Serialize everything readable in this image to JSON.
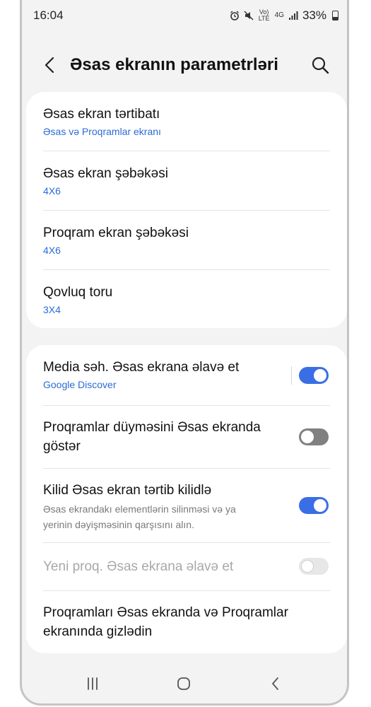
{
  "status": {
    "time": "16:04",
    "volte": "Vo) LTE",
    "network": "4G",
    "battery": "33%",
    "icons": [
      "alarm-icon",
      "mute-icon",
      "volte-icon",
      "4g-icon",
      "signal-icon",
      "battery-icon"
    ]
  },
  "header": {
    "title": "Əsas ekranın parametrləri",
    "back_icon": "back-icon",
    "search_icon": "search-icon"
  },
  "card1": {
    "items": [
      {
        "title": "Əsas ekran tərtibatı",
        "subtitle": "Əsas və Proqramlar ekranı"
      },
      {
        "title": "Əsas ekran şəbəkəsi",
        "subtitle": "4X6"
      },
      {
        "title": "Proqram ekran şəbəkəsi",
        "subtitle": "4X6"
      },
      {
        "title": "Qovluq toru",
        "subtitle": "3X4"
      }
    ]
  },
  "card2": {
    "items": [
      {
        "title": "Media səh. Əsas ekrana əlavə et",
        "subtitle": "Google Discover",
        "toggle": "on"
      },
      {
        "title_line1": "Proqramlar düyməsini Əsas ekranda",
        "title_line2": "göstər",
        "toggle": "off"
      },
      {
        "title": "Kilid Əsas ekran tərtib kilidlə",
        "desc_line1": "Əsas ekrandakı elementlərin silinməsi və ya",
        "desc_line2": "yerinin dəyişməsinin qarşısını alın.",
        "toggle": "on"
      },
      {
        "title": "Yeni proq. Əsas ekrana əlavə et",
        "toggle": "off-disabled"
      },
      {
        "title_line1": "Proqramları Əsas ekranda və Proqramlar",
        "title_line2": "ekranında gizlədin"
      }
    ]
  },
  "navbar": {
    "icons": [
      "recents-icon",
      "home-icon",
      "back-nav-icon"
    ]
  },
  "colors": {
    "accent": "#3a6ee4",
    "link": "#2b6bd6",
    "background": "#f3f3f3",
    "card": "#ffffff"
  }
}
